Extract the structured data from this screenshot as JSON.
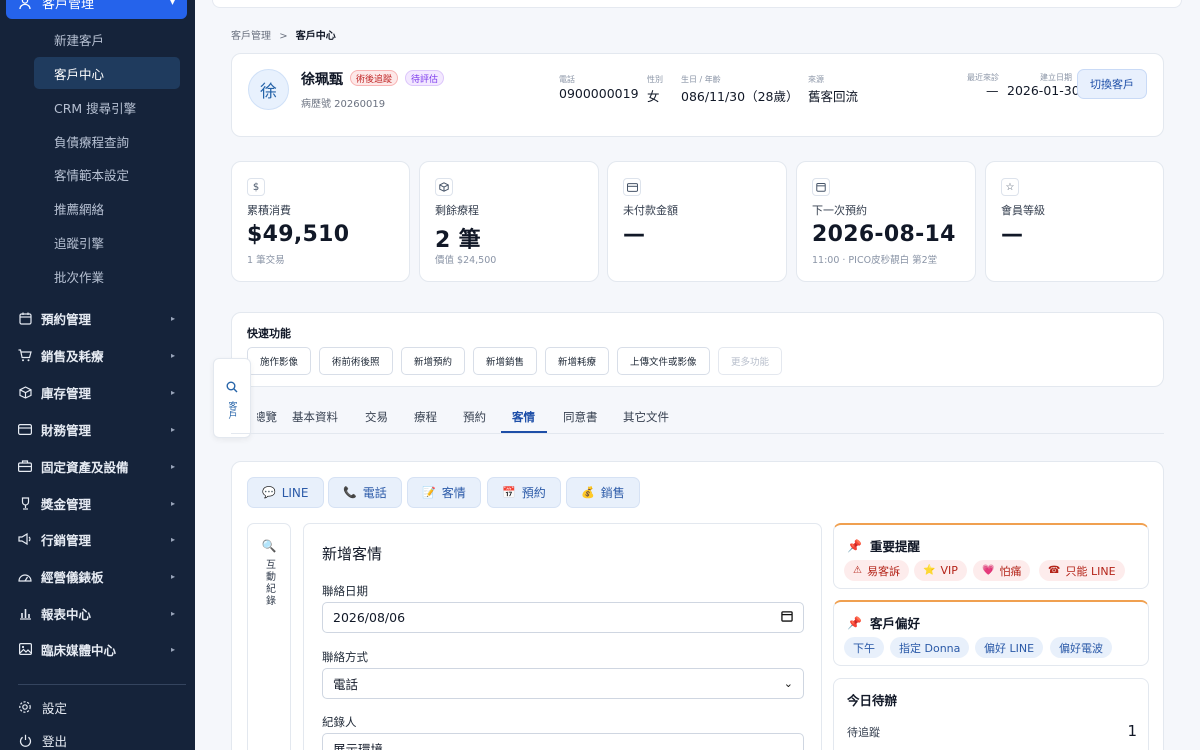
{
  "sidebar": {
    "top_item": "客戶管理",
    "sub_items": [
      "新建客戶",
      "客戶中心",
      "CRM 搜尋引擎",
      "負債療程查詢",
      "客情範本設定",
      "推薦網絡",
      "追蹤引擎",
      "批次作業"
    ],
    "groups": [
      "預約管理",
      "銷售及耗療",
      "庫存管理",
      "財務管理",
      "固定資產及設備",
      "獎金管理",
      "行銷管理",
      "經營儀錶板",
      "報表中心",
      "臨床媒體中心"
    ],
    "footer": [
      "設定",
      "登出"
    ]
  },
  "breadcrumb": {
    "parent": "客戶管理",
    "sep": ">",
    "current": "客戶中心"
  },
  "patient": {
    "avatar": "徐",
    "name": "徐珮甄",
    "tags": [
      "術後追蹤",
      "待評估"
    ],
    "record_no": "病歷號 20260019",
    "fields": [
      {
        "label": "電話",
        "value": "0900000019"
      },
      {
        "label": "性別",
        "value": "女"
      },
      {
        "label": "生日 / 年齡",
        "value": "086/11/30（28歲）"
      },
      {
        "label": "來源",
        "value": "舊客回流"
      },
      {
        "label": "最近來診",
        "value": "—"
      },
      {
        "label": "建立日期",
        "value": "2026-01-30"
      }
    ],
    "switch_button": "切換客戶"
  },
  "stats": [
    {
      "icon": "dollar-icon",
      "label": "累積消費",
      "value": "$49,510",
      "sub": "1 筆交易"
    },
    {
      "icon": "box-icon",
      "label": "剩餘療程",
      "value": "2 筆",
      "sub": "價值 $24,500"
    },
    {
      "icon": "card-icon",
      "label": "未付款金額",
      "value": "—",
      "sub": ""
    },
    {
      "icon": "calendar-icon",
      "label": "下一次預約",
      "value": "2026-08-14",
      "sub": "11:00 · PICO皮秒靚白 第2堂"
    },
    {
      "icon": "star-icon",
      "label": "會員等級",
      "value": "—",
      "sub": ""
    }
  ],
  "quick": {
    "title": "快速功能",
    "buttons": [
      "施作影像",
      "術前術後照",
      "新增預約",
      "新增銷售",
      "新增耗療",
      "上傳文件或影像",
      "更多功能"
    ]
  },
  "floater": {
    "label": "客戶"
  },
  "tabs": [
    "總覽",
    "基本資料",
    "交易",
    "療程",
    "預約",
    "客情",
    "同意書",
    "其它文件"
  ],
  "active_tab": "客情",
  "contact_chips": [
    {
      "emoji": "💬",
      "label": "LINE"
    },
    {
      "emoji": "📞",
      "label": "電話"
    },
    {
      "emoji": "📝",
      "label": "客情"
    },
    {
      "emoji": "📅",
      "label": "預約"
    },
    {
      "emoji": "💰",
      "label": "銷售"
    }
  ],
  "side_tab": {
    "emoji": "🔍",
    "label": "互動紀錄"
  },
  "form": {
    "title": "新增客情",
    "date_label": "聯絡日期",
    "date_value": "2026/08/06",
    "method_label": "聯絡方式",
    "method_value": "電話",
    "recorder_label": "紀錄人",
    "recorder_value": "展示環境"
  },
  "reminders": {
    "title": "重要提醒",
    "items": [
      {
        "emoji": "⚠",
        "label": "易客訴"
      },
      {
        "emoji": "⭐",
        "label": "VIP"
      },
      {
        "emoji": "💗",
        "label": "怕痛"
      },
      {
        "emoji": "☎",
        "label": "只能 LINE"
      }
    ]
  },
  "preferences": {
    "title": "客戶偏好",
    "items": [
      "下午",
      "指定 Donna",
      "偏好 LINE",
      "偏好電波"
    ]
  },
  "todo": {
    "title": "今日待辦",
    "row_label": "待追蹤",
    "row_count": "1"
  }
}
